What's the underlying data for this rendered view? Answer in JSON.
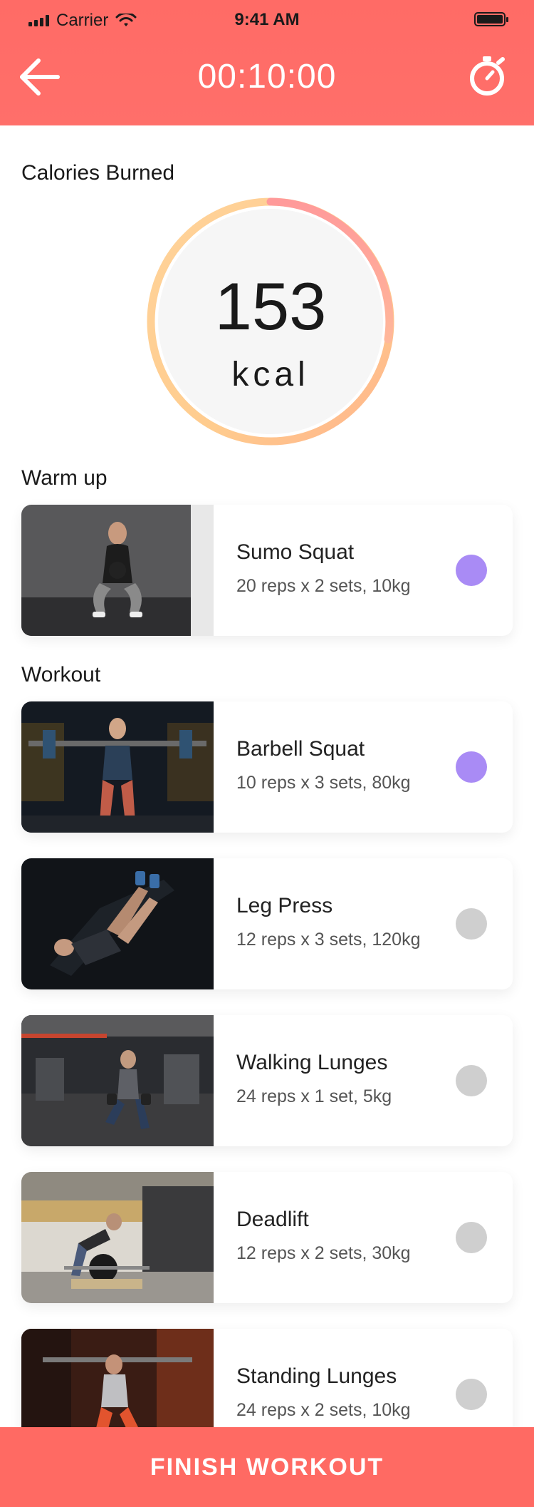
{
  "status_bar": {
    "carrier": "Carrier",
    "time": "9:41 AM"
  },
  "header": {
    "timer": "00:10:00",
    "back_icon": "arrow-left-icon",
    "stopwatch_icon": "stopwatch-icon"
  },
  "calories": {
    "title": "Calories Burned",
    "value": "153",
    "unit": "kcal"
  },
  "sections": {
    "warmup_title": "Warm up",
    "workout_title": "Workout"
  },
  "warmup": [
    {
      "name": "Sumo Squat",
      "detail": "20 reps x 2 sets, 10kg",
      "completed": true
    }
  ],
  "workout": [
    {
      "name": "Barbell Squat",
      "detail": "10 reps x 3 sets, 80kg",
      "completed": true
    },
    {
      "name": "Leg Press",
      "detail": "12 reps x 3 sets, 120kg",
      "completed": false
    },
    {
      "name": "Walking Lunges",
      "detail": "24 reps x 1 set, 5kg",
      "completed": false
    },
    {
      "name": "Deadlift",
      "detail": "12 reps x 2 sets, 30kg",
      "completed": false
    },
    {
      "name": "Standing Lunges",
      "detail": "24 reps x 2 sets, 10kg",
      "completed": false
    }
  ],
  "finish_button": "FINISH WORKOUT",
  "colors": {
    "accent": "#ff6b66",
    "completed": "#a98bf5",
    "pending": "#cfcfcf"
  }
}
